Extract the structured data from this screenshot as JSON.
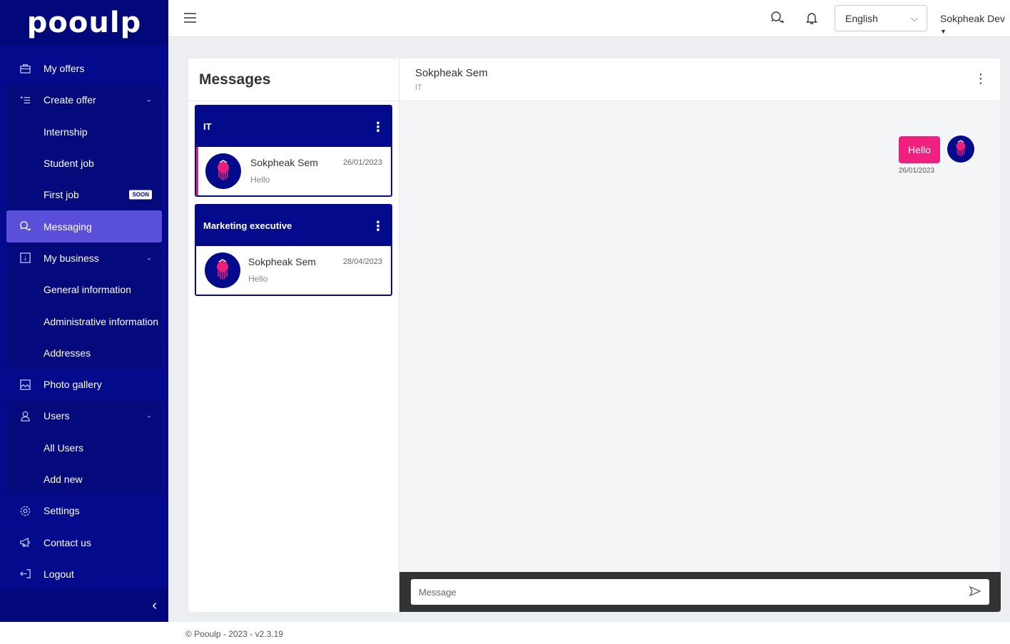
{
  "app": {
    "logo_text": "pooulp"
  },
  "sidebar": {
    "my_offers": "My offers",
    "create_offer": "Create offer",
    "internship": "Internship",
    "student_job": "Student job",
    "first_job": "First job",
    "first_job_badge": "SOON",
    "messaging": "Messaging",
    "my_business": "My business",
    "general_information": "General information",
    "administrative_information": "Administrative information",
    "addresses": "Addresses",
    "photo_gallery": "Photo gallery",
    "users": "Users",
    "all_users": "All Users",
    "add_new": "Add new",
    "settings": "Settings",
    "contact_us": "Contact us",
    "logout": "Logout"
  },
  "topbar": {
    "language": "English",
    "user_name": "Sokpheak Dev"
  },
  "messages": {
    "title": "Messages",
    "conversations": [
      {
        "group": "IT",
        "name": "Sokpheak Sem",
        "date": "26/01/2023",
        "last": "Hello"
      },
      {
        "group": "Marketing executive",
        "name": "Sokpheak Sem",
        "date": "28/04/2023",
        "last": "Hello"
      }
    ]
  },
  "chat": {
    "name": "Sokpheak Sem",
    "subtitle": "IT",
    "message_text": "Hello",
    "message_date": "26/01/2023",
    "input_placeholder": "Message"
  },
  "footer": {
    "text": "© Pooulp - 2023 - v2.3.19"
  },
  "colors": {
    "brand": "#030a8c",
    "active": "#5a4fd8",
    "accent": "#f0207f"
  }
}
